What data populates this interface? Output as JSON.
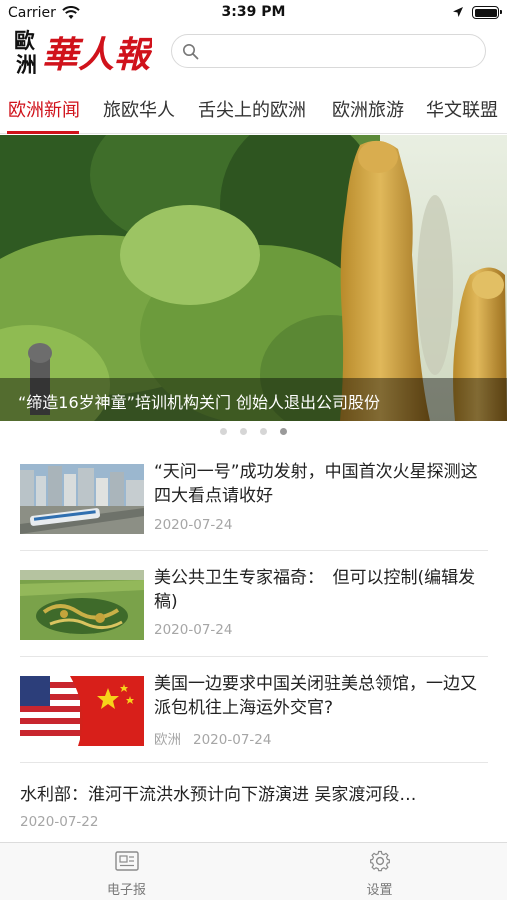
{
  "status_bar": {
    "carrier": "Carrier",
    "time": "3:39 PM"
  },
  "header": {
    "logo_text": "歐洲華人報",
    "search": {
      "placeholder": "",
      "value": ""
    }
  },
  "tabs": [
    {
      "label": "欧洲新闻",
      "active": true
    },
    {
      "label": "旅欧华人",
      "active": false
    },
    {
      "label": "舌尖上的欧洲",
      "active": false
    },
    {
      "label": "欧洲旅游",
      "active": false
    },
    {
      "label": "华文联盟",
      "active": false
    }
  ],
  "banner": {
    "caption": "“缔造16岁神童”培训机构关门 创始人退出公司股份",
    "dot_count": 4,
    "active_dot": 4
  },
  "articles": [
    {
      "title": "“天问一号”成功发射，中国首次火星探测这四大看点请收好",
      "source": "",
      "date": "2020-07-24",
      "thumb": "city-train"
    },
    {
      "title": "美公共卫生专家福奇：　但可以控制(编辑发稿)",
      "source": "",
      "date": "2020-07-24",
      "thumb": "rice-field"
    },
    {
      "title": "美国一边要求中国关闭驻美总领馆，一边又派包机往上海运外交官?",
      "source": "欧洲",
      "date": "2020-07-24",
      "thumb": "us-china-flags"
    },
    {
      "title": "水利部：淮河干流洪水预计向下游演进 吴家渡河段…",
      "source": "",
      "date": "2020-07-22",
      "thumb": ""
    }
  ],
  "tabbar": [
    {
      "label": "电子报",
      "icon": "newspaper-icon"
    },
    {
      "label": "设置",
      "icon": "gear-icon"
    }
  ],
  "colors": {
    "accent": "#d0121b"
  }
}
